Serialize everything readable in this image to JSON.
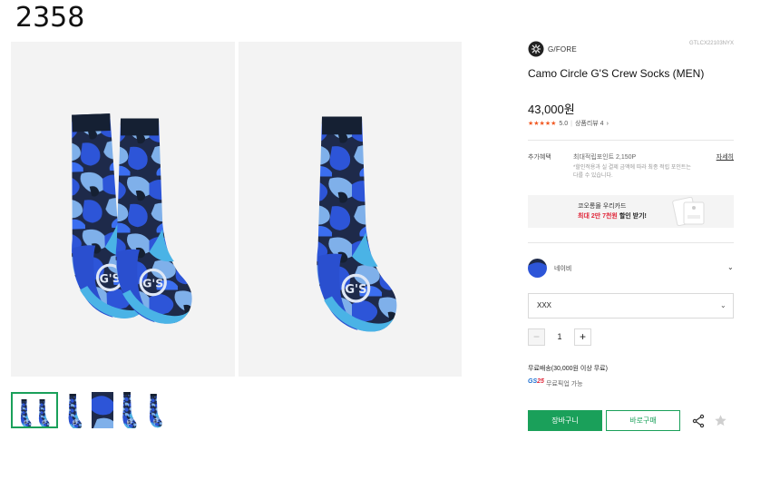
{
  "page_id": "2358",
  "product": {
    "brand": "G/FORE",
    "code": "GTLCX22103NYX",
    "title": "Camo Circle G'S Crew Socks (MEN)",
    "price": "43,000원",
    "rating": {
      "stars": "★★★★★",
      "score": "5.0",
      "separator": "|",
      "review_label": "상품리뷰 4",
      "review_arrow": "›"
    }
  },
  "benefit": {
    "label": "추가혜택",
    "points": "최대적립포인트 2,150P",
    "detail_link": "자세히",
    "note": "*할인적용과 실 결제 금액에 따라 최종 적립 포인트는 다를 수 있습니다."
  },
  "promo": {
    "line1": "코오롱몰 우리카드",
    "line2_red": "최대 2만 7천원",
    "line2_rest": " 할인 받기!"
  },
  "option": {
    "color_name": "네이비",
    "color_chevron": "⌄",
    "size_value": "XXX",
    "size_chevron": "⌄",
    "quantity": "1",
    "minus": "−",
    "plus": "+"
  },
  "shipping": {
    "text": "무료배송(30,000원 이상 무료)",
    "gs_part1": "GS",
    "gs_part2": "25",
    "pickup": "무료픽업 가능"
  },
  "actions": {
    "cart": "장바구니",
    "buy": "바로구매"
  },
  "icons": {
    "share": "share-icon",
    "wishlist": "star-icon",
    "brand": "gfore-logo-icon"
  },
  "colors": {
    "accent_green": "#1aa05a",
    "rating_orange": "#f15a24",
    "promo_red": "#e0283b",
    "sock_navy": "#152033",
    "sock_blue": "#2d55d8",
    "sock_light_blue": "#7fb0ea",
    "sock_sky": "#4ab3e6"
  }
}
